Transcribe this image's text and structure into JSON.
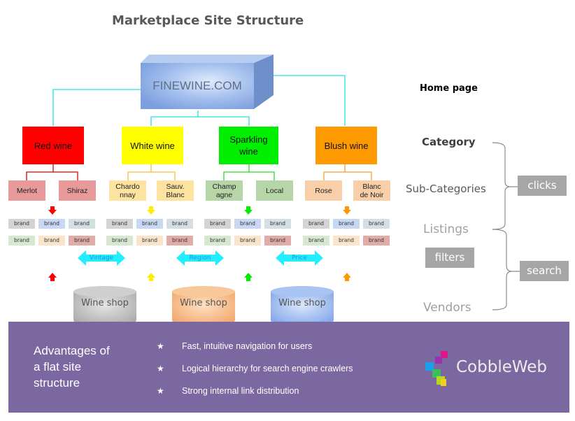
{
  "title": "Marketplace Site Structure",
  "home": {
    "label": "FINEWINE.COM",
    "color": "#9ab8ec"
  },
  "connector_color": "#20e0e8",
  "categories": [
    {
      "label": "Red wine",
      "color": "#ff0000",
      "line_color": "#e00000",
      "subs": [
        {
          "label": "Merlot",
          "color": "#e89a9a"
        },
        {
          "label": "Shiraz",
          "color": "#e89a9a"
        }
      ]
    },
    {
      "label": "White wine",
      "color": "#ffff00",
      "line_color": "#f0c040",
      "subs": [
        {
          "label": "Chardo nnay",
          "color": "#fde2a0"
        },
        {
          "label": "Sauv. Blanc",
          "color": "#fde2a0"
        }
      ]
    },
    {
      "label": "Sparkling wine",
      "color": "#00ee00",
      "line_color": "#22dd22",
      "subs": [
        {
          "label": "Champ agne",
          "color": "#b6d6a8"
        },
        {
          "label": "Local",
          "color": "#b6d6a8"
        }
      ]
    },
    {
      "label": "Blush wine",
      "color": "#ff9900",
      "line_color": "#f0a030",
      "subs": [
        {
          "label": "Rose",
          "color": "#f8cfa8"
        },
        {
          "label": "Blanc de Noir",
          "color": "#f8cfa8"
        }
      ]
    }
  ],
  "brand_label": "brand",
  "brand_colors": [
    "#d4d4d4",
    "#c8d8f4",
    "#d2dfe3",
    "#d8e8d0",
    "#fbe4cc",
    "#e1aca8"
  ],
  "filters": [
    "Vintage",
    "Region",
    "Price"
  ],
  "shops": [
    {
      "label": "Wine shop",
      "color": "#bfbfbf"
    },
    {
      "label": "Wine shop",
      "color": "#f6b27a"
    },
    {
      "label": "Wine shop",
      "color": "#8eb0ee"
    }
  ],
  "levels": {
    "home": "Home page",
    "category": "Category",
    "subcategories": "Sub-Categories",
    "listings": "Listings",
    "vendors": "Vendors"
  },
  "tags": {
    "clicks": "clicks",
    "filters": "filters",
    "search": "search"
  },
  "footer": {
    "heading": "Advantages of a flat site structure",
    "heading_lines": [
      "Advantages of",
      "a flat site",
      "structure"
    ],
    "bullets": [
      "Fast, intuitive navigation for users",
      "Logical hierarchy for search engine crawlers",
      "Strong internal link distribution"
    ],
    "star_icon": "★",
    "background": "#7b68a0"
  },
  "logo": {
    "text": "CobbleWeb"
  }
}
